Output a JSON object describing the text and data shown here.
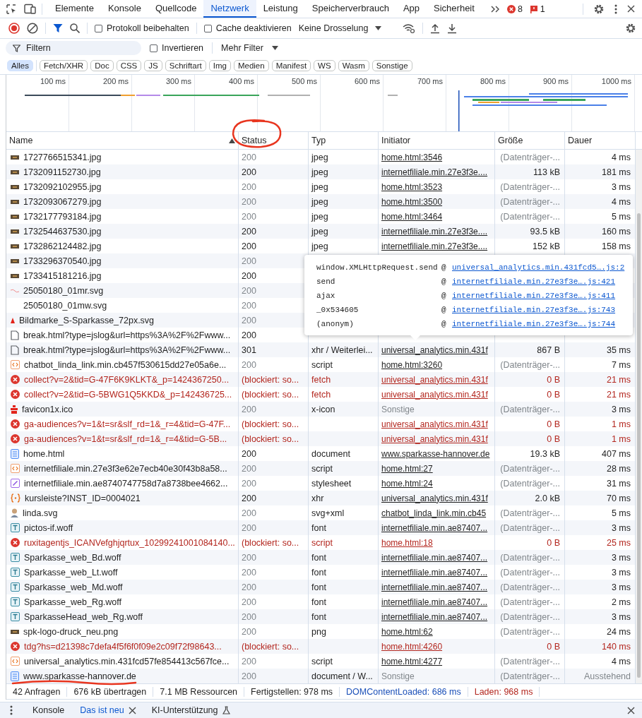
{
  "tabs": [
    {
      "label": "Elemente",
      "selected": false
    },
    {
      "label": "Konsole",
      "selected": false
    },
    {
      "label": "Quellcode",
      "selected": false
    },
    {
      "label": "Netzwerk",
      "selected": true
    },
    {
      "label": "Leistung",
      "selected": false
    },
    {
      "label": "Speicherverbrauch",
      "selected": false
    },
    {
      "label": "App",
      "selected": false
    },
    {
      "label": "Sicherheit",
      "selected": false
    }
  ],
  "badges": {
    "errors": "8",
    "issues": "1"
  },
  "toolbar": {
    "checkboxes": [
      {
        "label": "Protokoll beibehalten",
        "checked": false
      },
      {
        "label": "Cache deaktivieren",
        "checked": false
      }
    ],
    "throttling": "Keine Drosselung"
  },
  "filter": {
    "placeholder": "Filtern",
    "invert": {
      "label": "Invertieren",
      "checked": false
    },
    "more": "Mehr Filter"
  },
  "type_filters": [
    {
      "label": "Alles",
      "selected": true
    },
    {
      "label": "Fetch/XHR",
      "selected": false
    },
    {
      "label": "Doc",
      "selected": false
    },
    {
      "label": "CSS",
      "selected": false
    },
    {
      "label": "JS",
      "selected": false
    },
    {
      "label": "Schriftart",
      "selected": false
    },
    {
      "label": "Img",
      "selected": false
    },
    {
      "label": "Medien",
      "selected": false
    },
    {
      "label": "Manifest",
      "selected": false
    },
    {
      "label": "WS",
      "selected": false
    },
    {
      "label": "Wasm",
      "selected": false
    },
    {
      "label": "Sonstige",
      "selected": false
    }
  ],
  "overview": {
    "ticks": [
      "100 ms",
      "200 ms",
      "300 ms",
      "400 ms",
      "500 ms",
      "600 ms",
      "700 ms",
      "800 ms",
      "900 ms",
      "1000 ms"
    ]
  },
  "table": {
    "columns": [
      {
        "label": "Name",
        "sorted": true
      },
      {
        "label": "Status",
        "sorted": false
      },
      {
        "label": "Typ",
        "sorted": false
      },
      {
        "label": "Initiator",
        "sorted": false
      },
      {
        "label": "Größe",
        "sorted": false
      },
      {
        "label": "Dauer",
        "sorted": false
      }
    ],
    "rows": [
      {
        "kind": "image",
        "name": "1727766515341.jpg",
        "status": "200",
        "cached": true,
        "blocked": false,
        "type": "jpeg",
        "initiator": "home.html:3546",
        "initiator_link": true,
        "size": "(Datenträger-...",
        "time": "4 ms"
      },
      {
        "kind": "image",
        "name": "1732091152730.jpg",
        "status": "200",
        "cached": false,
        "blocked": false,
        "type": "jpeg",
        "initiator": "internetfiliale.min.27e3f3e....",
        "initiator_link": true,
        "size": "113 kB",
        "time": "181 ms"
      },
      {
        "kind": "image",
        "name": "1732092102955.jpg",
        "status": "200",
        "cached": true,
        "blocked": false,
        "type": "jpeg",
        "initiator": "home.html:3523",
        "initiator_link": true,
        "size": "(Datenträger-...",
        "time": "3 ms"
      },
      {
        "kind": "image",
        "name": "1732093067279.jpg",
        "status": "200",
        "cached": true,
        "blocked": false,
        "type": "jpeg",
        "initiator": "home.html:3500",
        "initiator_link": true,
        "size": "(Datenträger-...",
        "time": "4 ms"
      },
      {
        "kind": "image",
        "name": "1732177793184.jpg",
        "status": "200",
        "cached": true,
        "blocked": false,
        "type": "jpeg",
        "initiator": "home.html:3464",
        "initiator_link": true,
        "size": "(Datenträger-...",
        "time": "5 ms"
      },
      {
        "kind": "image",
        "name": "1732544637530.jpg",
        "status": "200",
        "cached": false,
        "blocked": false,
        "type": "jpeg",
        "initiator": "internetfiliale.min.27e3f3e....",
        "initiator_link": true,
        "size": "93.5 kB",
        "time": "160 ms"
      },
      {
        "kind": "image",
        "name": "1732862124482.jpg",
        "status": "200",
        "cached": false,
        "blocked": false,
        "type": "jpeg",
        "initiator": "internetfiliale.min.27e3f3e....",
        "initiator_link": true,
        "size": "152 kB",
        "time": "158 ms"
      },
      {
        "kind": "image",
        "name": "1733296370540.jpg",
        "status": "200",
        "cached": true,
        "blocked": false
      },
      {
        "kind": "image",
        "name": "1733415181216.jpg",
        "status": "200",
        "cached": false,
        "blocked": false
      },
      {
        "kind": "sketch",
        "name": "25050180_01mr.svg",
        "status": "200",
        "cached": true,
        "blocked": false
      },
      {
        "kind": "plain",
        "name": "25050180_01mw.svg",
        "status": "200",
        "cached": true,
        "blocked": false
      },
      {
        "kind": "mark",
        "name": "Bildmarke_S-Sparkasse_72px.svg",
        "status": "200",
        "cached": true,
        "blocked": false
      },
      {
        "kind": "blank",
        "name": "break.html?type=jslog&url=https%3A%2F%2Fwww...",
        "status": "200",
        "cached": false,
        "blocked": false
      },
      {
        "kind": "blank",
        "name": "break.html?type=jslog&url=https%3A%2F%2Fwww...",
        "status": "301",
        "cached": false,
        "blocked": false,
        "type": "xhr / Weiterlei...",
        "initiator": "universal_analytics.min.431f",
        "initiator_link": true,
        "size": "867 B",
        "time": "35 ms"
      },
      {
        "kind": "script",
        "name": "chatbot_linda_link.min.cb457f530615dd27e05a6e...",
        "status": "200",
        "cached": true,
        "blocked": false,
        "type": "script",
        "initiator": "home.html:3260",
        "initiator_link": true,
        "size": "(Datenträger-...",
        "time": "7 ms"
      },
      {
        "kind": "error",
        "name": "collect?v=2&tid=G-47F6K9KLKT&_p=1424367250...",
        "status": "(blockiert: so...",
        "cached": false,
        "blocked": true,
        "type": "fetch",
        "initiator": "universal_analytics.min.431f",
        "initiator_link": true,
        "size": "0 B",
        "time": "21 ms"
      },
      {
        "kind": "error",
        "name": "collect?v=2&tid=G-5BWG1Q5KKD&_p=142436725...",
        "status": "(blockiert: so...",
        "cached": false,
        "blocked": true,
        "type": "fetch",
        "initiator": "universal_analytics.min.431f",
        "initiator_link": true,
        "size": "0 B",
        "time": "21 ms"
      },
      {
        "kind": "favicon",
        "name": "favicon1x.ico",
        "status": "200",
        "cached": true,
        "blocked": false,
        "type": "x-icon",
        "initiator": "Sonstige",
        "initiator_link": false,
        "size": "(Datenträger-...",
        "time": "3 ms"
      },
      {
        "kind": "error",
        "name": "ga-audiences?v=1&t=sr&slf_rd=1&_r=4&tid=G-47F...",
        "status": "(blockiert: so...",
        "cached": false,
        "blocked": true,
        "initiator": "universal_analytics.min.431f",
        "initiator_link": true,
        "size": "0 B",
        "time": "1 ms"
      },
      {
        "kind": "error",
        "name": "ga-audiences?v=1&t=sr&slf_rd=1&_r=4&tid=G-5B...",
        "status": "(blockiert: so...",
        "cached": false,
        "blocked": true,
        "initiator": "universal_analytics.min.431f",
        "initiator_link": true,
        "size": "0 B",
        "time": "1 ms"
      },
      {
        "kind": "document",
        "name": "home.html",
        "status": "200",
        "cached": false,
        "blocked": false,
        "type": "document",
        "initiator": "www.sparkasse-hannover.de",
        "initiator_link": true,
        "size": "19.3 kB",
        "time": "407 ms"
      },
      {
        "kind": "script",
        "name": "internetfiliale.min.27e3f3e62e7ecb40e30f43b8a58...",
        "status": "200",
        "cached": true,
        "blocked": false,
        "type": "script",
        "initiator": "home.html:27",
        "initiator_link": true,
        "size": "(Datenträger-...",
        "time": "28 ms"
      },
      {
        "kind": "stylesheet",
        "name": "internetfiliale.min.ae8740747758d7a8738bee4662...",
        "status": "200",
        "cached": true,
        "blocked": false,
        "type": "stylesheet",
        "initiator": "home.html:24",
        "initiator_link": true,
        "size": "(Datenträger-...",
        "time": "31 ms"
      },
      {
        "kind": "xhr",
        "name": "kursleiste?INST_ID=0004021",
        "status": "200",
        "cached": false,
        "blocked": false,
        "type": "xhr",
        "initiator": "universal_analytics.min.431f",
        "initiator_link": true,
        "size": "2.0 kB",
        "time": "70 ms"
      },
      {
        "kind": "avatar",
        "name": "linda.svg",
        "status": "200",
        "cached": true,
        "blocked": false,
        "type": "svg+xml",
        "initiator": "chatbot_linda_link.min.cb45",
        "initiator_link": true,
        "size": "(Datenträger-...",
        "time": "5 ms"
      },
      {
        "kind": "font",
        "name": "pictos-if.woff",
        "status": "200",
        "cached": true,
        "blocked": false,
        "type": "font",
        "initiator": "internetfiliale.min.ae87407...",
        "initiator_link": true,
        "size": "(Datenträger-...",
        "time": "3 ms"
      },
      {
        "kind": "error",
        "name": "ruxitagentjs_ICANVefghjqrtux_10299241001084140...",
        "status": "(blockiert: so...",
        "cached": false,
        "blocked": true,
        "type": "script",
        "initiator": "home.html:18",
        "initiator_link": true,
        "size": "0 B",
        "time": "25 ms"
      },
      {
        "kind": "font",
        "name": "Sparkasse_web_Bd.woff",
        "status": "200",
        "cached": true,
        "blocked": false,
        "type": "font",
        "initiator": "internetfiliale.min.ae87407...",
        "initiator_link": true,
        "size": "(Datenträger-...",
        "time": "3 ms"
      },
      {
        "kind": "font",
        "name": "Sparkasse_web_Lt.woff",
        "status": "200",
        "cached": true,
        "blocked": false,
        "type": "font",
        "initiator": "internetfiliale.min.ae87407...",
        "initiator_link": true,
        "size": "(Datenträger-...",
        "time": "3 ms"
      },
      {
        "kind": "font",
        "name": "Sparkasse_web_Md.woff",
        "status": "200",
        "cached": true,
        "blocked": false,
        "type": "font",
        "initiator": "internetfiliale.min.ae87407...",
        "initiator_link": true,
        "size": "(Datenträger-...",
        "time": "3 ms"
      },
      {
        "kind": "font",
        "name": "Sparkasse_web_Rg.woff",
        "status": "200",
        "cached": true,
        "blocked": false,
        "type": "font",
        "initiator": "internetfiliale.min.ae87407...",
        "initiator_link": true,
        "size": "(Datenträger-...",
        "time": "2 ms"
      },
      {
        "kind": "font",
        "name": "SparkasseHead_web_Rg.woff",
        "status": "200",
        "cached": true,
        "blocked": false,
        "type": "font",
        "initiator": "internetfiliale.min.ae87407...",
        "initiator_link": true,
        "size": "(Datenträger-...",
        "time": "3 ms"
      },
      {
        "kind": "image",
        "name": "spk-logo-druck_neu.png",
        "status": "200",
        "cached": true,
        "blocked": false,
        "type": "png",
        "initiator": "home.html:62",
        "initiator_link": true,
        "size": "(Datenträger-...",
        "time": "24 ms"
      },
      {
        "kind": "error",
        "name": "tdg?hs=d21398c7defa4f5f6f0f09e2c09f72f98643...",
        "status": "(blockiert: so...",
        "cached": false,
        "blocked": true,
        "initiator": "home.html:4260",
        "initiator_link": true,
        "size": "0 B",
        "time": "140 ms"
      },
      {
        "kind": "script",
        "name": "universal_analytics.min.431fcd57fe854413c567fce...",
        "status": "200",
        "cached": true,
        "blocked": false,
        "type": "script",
        "initiator": "home.html:4277",
        "initiator_link": true,
        "size": "(Datenträger-...",
        "time": "4 ms"
      },
      {
        "kind": "document",
        "name": "www.sparkasse-hannover.de",
        "status": "200",
        "cached": true,
        "blocked": false,
        "pending": true,
        "type": "document / W...",
        "initiator": "Sonstige",
        "initiator_link": false,
        "size": "(Datenträger-...",
        "time": "Ausstehend"
      }
    ]
  },
  "tooltip": {
    "frames": [
      {
        "function": "window.XMLHttpRequest.send",
        "at": "@",
        "location": "universal_analytics.min.431fcd5….js:2"
      },
      {
        "function": "send",
        "at": "@",
        "location": "internetfiliale.min.27e3f3e….js:421"
      },
      {
        "function": "ajax",
        "at": "@",
        "location": "internetfiliale.min.27e3f3e….js:411"
      },
      {
        "function": "_0x534605",
        "at": "@",
        "location": "internetfiliale.min.27e3f3e….js:743"
      },
      {
        "function": "(anonym)",
        "at": "@",
        "location": "internetfiliale.min.27e3f3e….js:744"
      }
    ]
  },
  "status_bar": [
    {
      "text": "42 Anfragen",
      "kind": "plain"
    },
    {
      "text": "676 kB übertragen",
      "kind": "plain"
    },
    {
      "text": "7.1 MB Ressourcen",
      "kind": "plain"
    },
    {
      "text": "Fertigstellen: 978 ms",
      "kind": "plain"
    },
    {
      "text": "DOMContentLoaded: 686 ms",
      "kind": "dcl"
    },
    {
      "text": "Laden: 968 ms",
      "kind": "load"
    }
  ],
  "drawer": {
    "tabs": [
      {
        "label": "Konsole",
        "selected": false,
        "closable": false,
        "experimental": false
      },
      {
        "label": "Das ist neu",
        "selected": true,
        "closable": true,
        "experimental": false
      },
      {
        "label": "KI-Unterstützung",
        "selected": false,
        "closable": false,
        "experimental": true
      }
    ]
  }
}
